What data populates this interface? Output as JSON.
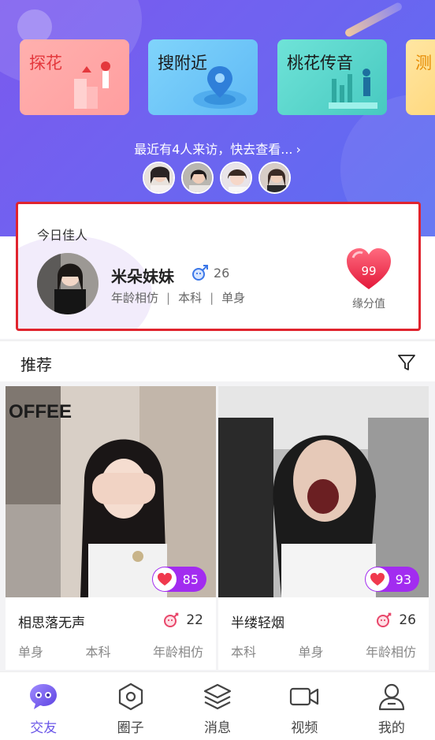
{
  "features": [
    {
      "label": "探花"
    },
    {
      "label": "搜附近"
    },
    {
      "label": "桃花传音"
    },
    {
      "label": "测"
    }
  ],
  "visit": {
    "text": "最近有4人来访，快去查看...",
    "chevron": "›",
    "count": 4
  },
  "today": {
    "title": "今日佳人",
    "name": "米朵妹妹",
    "age": "26",
    "gender_icon": "male-icon",
    "tags": [
      "年龄相仿",
      "本科",
      "单身"
    ],
    "tag_separator": "|",
    "score": "99",
    "score_label": "缘分值"
  },
  "recommend": {
    "title": "推荐"
  },
  "profiles": [
    {
      "name": "相思落无声",
      "age": "22",
      "score": "85",
      "tags": [
        "单身",
        "本科",
        "年龄相仿"
      ]
    },
    {
      "name": "半缕轻烟",
      "age": "26",
      "score": "93",
      "tags": [
        "本科",
        "单身",
        "年龄相仿"
      ]
    }
  ],
  "nav": [
    {
      "label": "交友",
      "icon": "chat-face-icon",
      "active": true
    },
    {
      "label": "圈子",
      "icon": "hexagon-icon",
      "active": false
    },
    {
      "label": "消息",
      "icon": "layers-icon",
      "active": false
    },
    {
      "label": "视频",
      "icon": "video-icon",
      "active": false
    },
    {
      "label": "我的",
      "icon": "person-icon",
      "active": false
    }
  ],
  "colors": {
    "accent": "#6a56e8",
    "highlight_border": "#e0242e",
    "score_pill": "#a22cf0",
    "heart": "#f0394e"
  }
}
